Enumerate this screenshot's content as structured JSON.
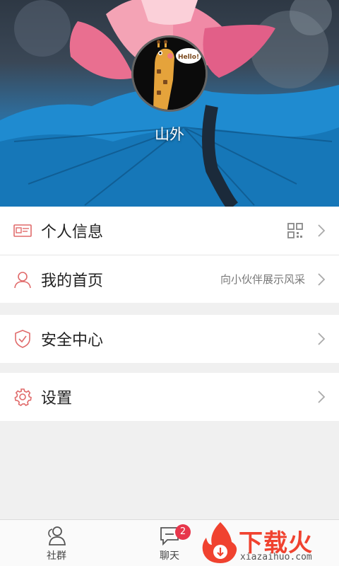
{
  "profile": {
    "username": "山外",
    "avatar_icon": "giraffe-hello-icon"
  },
  "menu": {
    "group1": [
      {
        "label": "个人信息",
        "icon": "id-card-icon",
        "right_icon": "qr-code-icon",
        "right_text": ""
      },
      {
        "label": "我的首页",
        "icon": "user-icon",
        "right_text": "向小伙伴展示风采"
      }
    ],
    "group2": [
      {
        "label": "安全中心",
        "icon": "shield-check-icon"
      }
    ],
    "group3": [
      {
        "label": "设置",
        "icon": "gear-icon"
      }
    ]
  },
  "tabbar": {
    "tabs": [
      {
        "label": "社群",
        "icon": "community-icon"
      },
      {
        "label": "聊天",
        "icon": "chat-icon",
        "badge": "2"
      }
    ]
  },
  "watermark": {
    "title": "下载火",
    "domain": "xiazaihuo.com"
  },
  "colors": {
    "accent_icon": "#e06a6a",
    "badge": "#e7364b",
    "watermark": "#f0422f"
  }
}
